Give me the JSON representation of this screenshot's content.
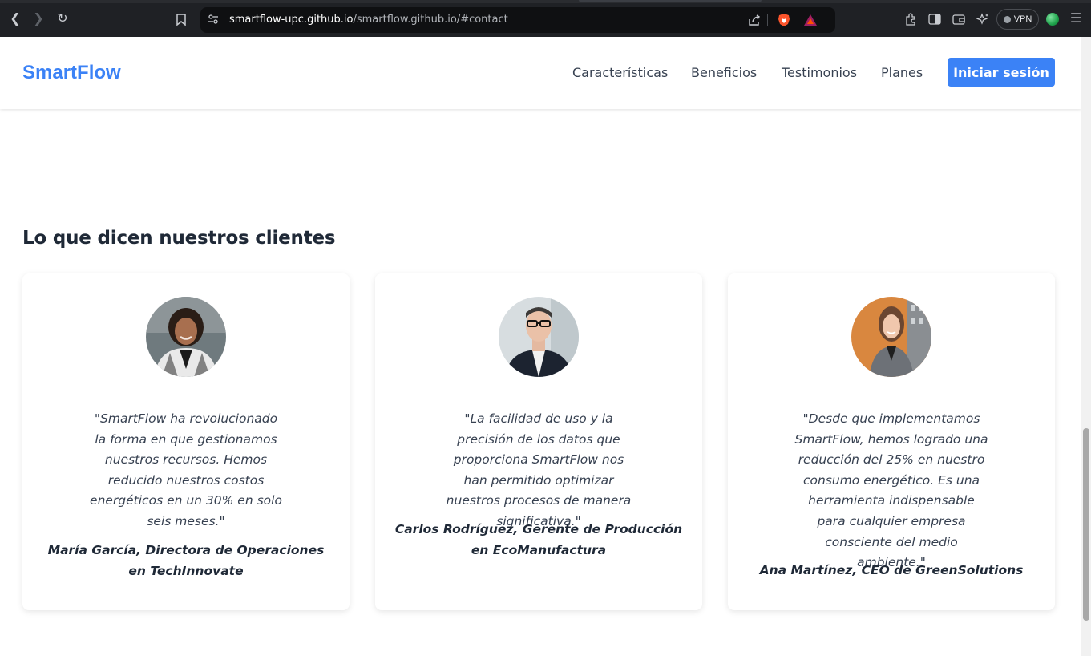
{
  "browser": {
    "url_host": "smartflow-upc.github.io",
    "url_path": "/smartflow.github.io/#contact",
    "vpn_label": "VPN"
  },
  "nav": {
    "logo": "SmartFlow",
    "links": [
      "Características",
      "Beneficios",
      "Testimonios",
      "Planes"
    ],
    "login": "Iniciar sesión"
  },
  "section": {
    "title": "Lo que dicen nuestros clientes"
  },
  "testimonials": [
    {
      "quote": "\"SmartFlow ha revolucionado la forma en que gestionamos nuestros recursos. Hemos reducido nuestros costos energéticos en un 30% en solo seis meses.\"",
      "author": "María García, Directora de Operaciones en TechInnovate"
    },
    {
      "quote": "\"La facilidad de uso y la precisión de los datos que proporciona SmartFlow nos han permitido optimizar nuestros procesos de manera significativa.\"",
      "author": "Carlos Rodríguez, Gerente de Producción en EcoManufactura"
    },
    {
      "quote": "\"Desde que implementamos SmartFlow, hemos logrado una reducción del 25% en nuestro consumo energético. Es una herramienta indispensable para cualquier empresa consciente del medio ambiente.\"",
      "author": "Ana Martínez, CEO de GreenSolutions"
    }
  ]
}
